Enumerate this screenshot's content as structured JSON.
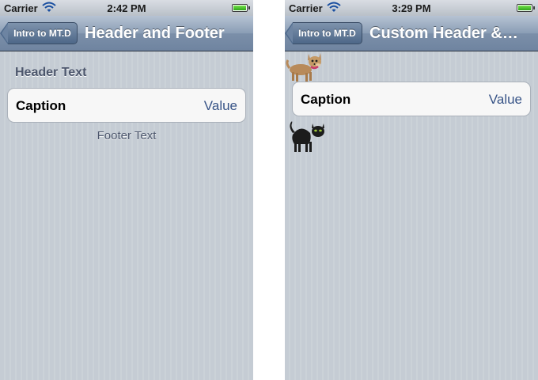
{
  "screens": [
    {
      "status": {
        "carrier": "Carrier",
        "time": "2:42 PM"
      },
      "nav": {
        "back_label": "Intro to MT.D",
        "title": "Header and Footer"
      },
      "section": {
        "header": "Header Text",
        "footer": "Footer Text"
      },
      "cell": {
        "caption": "Caption",
        "value": "Value"
      }
    },
    {
      "status": {
        "carrier": "Carrier",
        "time": "3:29 PM"
      },
      "nav": {
        "back_label": "Intro to MT.D",
        "title": "Custom Header &…"
      },
      "section": {
        "header_image": "dog-image",
        "footer_image": "cat-image"
      },
      "cell": {
        "caption": "Caption",
        "value": "Value"
      }
    }
  ],
  "colors": {
    "nav_bar": "#7b8fa9",
    "background_stripes": "#c5ccd4",
    "section_text": "#4c566c",
    "detail_value": "#385487",
    "battery": "#2fa51c"
  },
  "battery_level": 1.0
}
